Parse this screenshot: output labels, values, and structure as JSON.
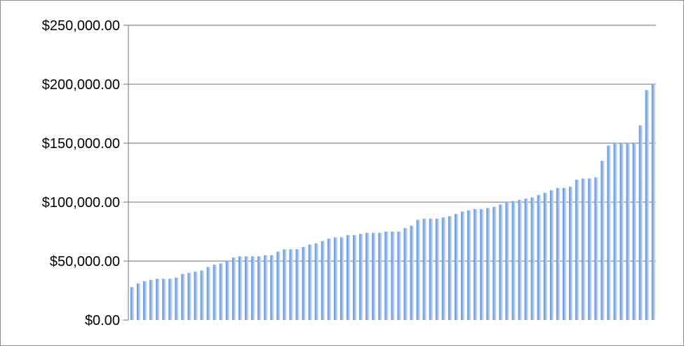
{
  "chart_data": {
    "type": "bar",
    "title": "",
    "xlabel": "",
    "ylabel": "",
    "ylim": [
      0,
      250000
    ],
    "yticks": [
      0,
      50000,
      100000,
      150000,
      200000,
      250000
    ],
    "ytick_labels": [
      "$0.00",
      "$50,000.00",
      "$100,000.00",
      "$150,000.00",
      "$200,000.00",
      "$250,000.00"
    ],
    "grid": true,
    "legend": "none",
    "bar_color": "#5b8fd8",
    "bar_highlight_color": "#c9dcf5",
    "values": [
      28000,
      31000,
      33000,
      34000,
      35000,
      35000,
      35000,
      36000,
      39000,
      40000,
      41000,
      42000,
      45000,
      47000,
      48000,
      50000,
      53000,
      54000,
      54000,
      54000,
      54000,
      55000,
      55000,
      58000,
      60000,
      60000,
      60000,
      62000,
      64000,
      65000,
      67000,
      69000,
      70000,
      70000,
      72000,
      72000,
      73000,
      74000,
      74000,
      74000,
      75000,
      75000,
      75000,
      78000,
      80000,
      85000,
      86000,
      86000,
      86000,
      87000,
      88000,
      90000,
      92000,
      93000,
      94000,
      94000,
      95000,
      96000,
      98000,
      100000,
      101000,
      102000,
      103000,
      104000,
      106000,
      108000,
      110000,
      112000,
      112000,
      113000,
      119000,
      120000,
      120000,
      121000,
      135000,
      148000,
      150000,
      150000,
      150000,
      150000,
      165000,
      195000,
      200000
    ]
  }
}
